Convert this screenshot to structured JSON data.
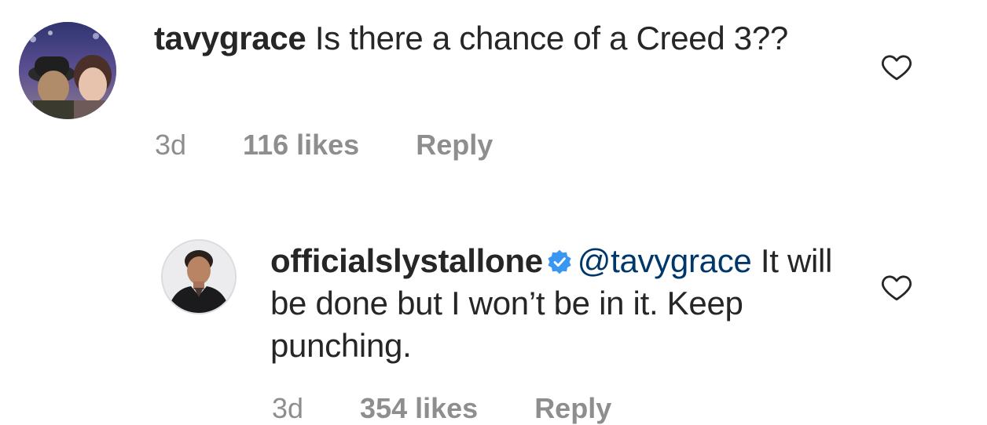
{
  "comments": [
    {
      "username": "tavygrace",
      "text": "Is there a chance of a Creed 3??",
      "time": "3d",
      "likes": "116 likes",
      "reply_label": "Reply"
    },
    {
      "username": "officialslystallone",
      "mention": "@tavygrace",
      "text": "It will be done but I won’t be in it. Keep punching.",
      "time": "3d",
      "likes": "354 likes",
      "reply_label": "Reply"
    }
  ],
  "colors": {
    "text": "#262626",
    "meta": "#8e8e8e",
    "mention": "#00376b",
    "verified": "#3897f0"
  },
  "icons": [
    "avatar",
    "heart-icon",
    "verified-badge-icon"
  ]
}
